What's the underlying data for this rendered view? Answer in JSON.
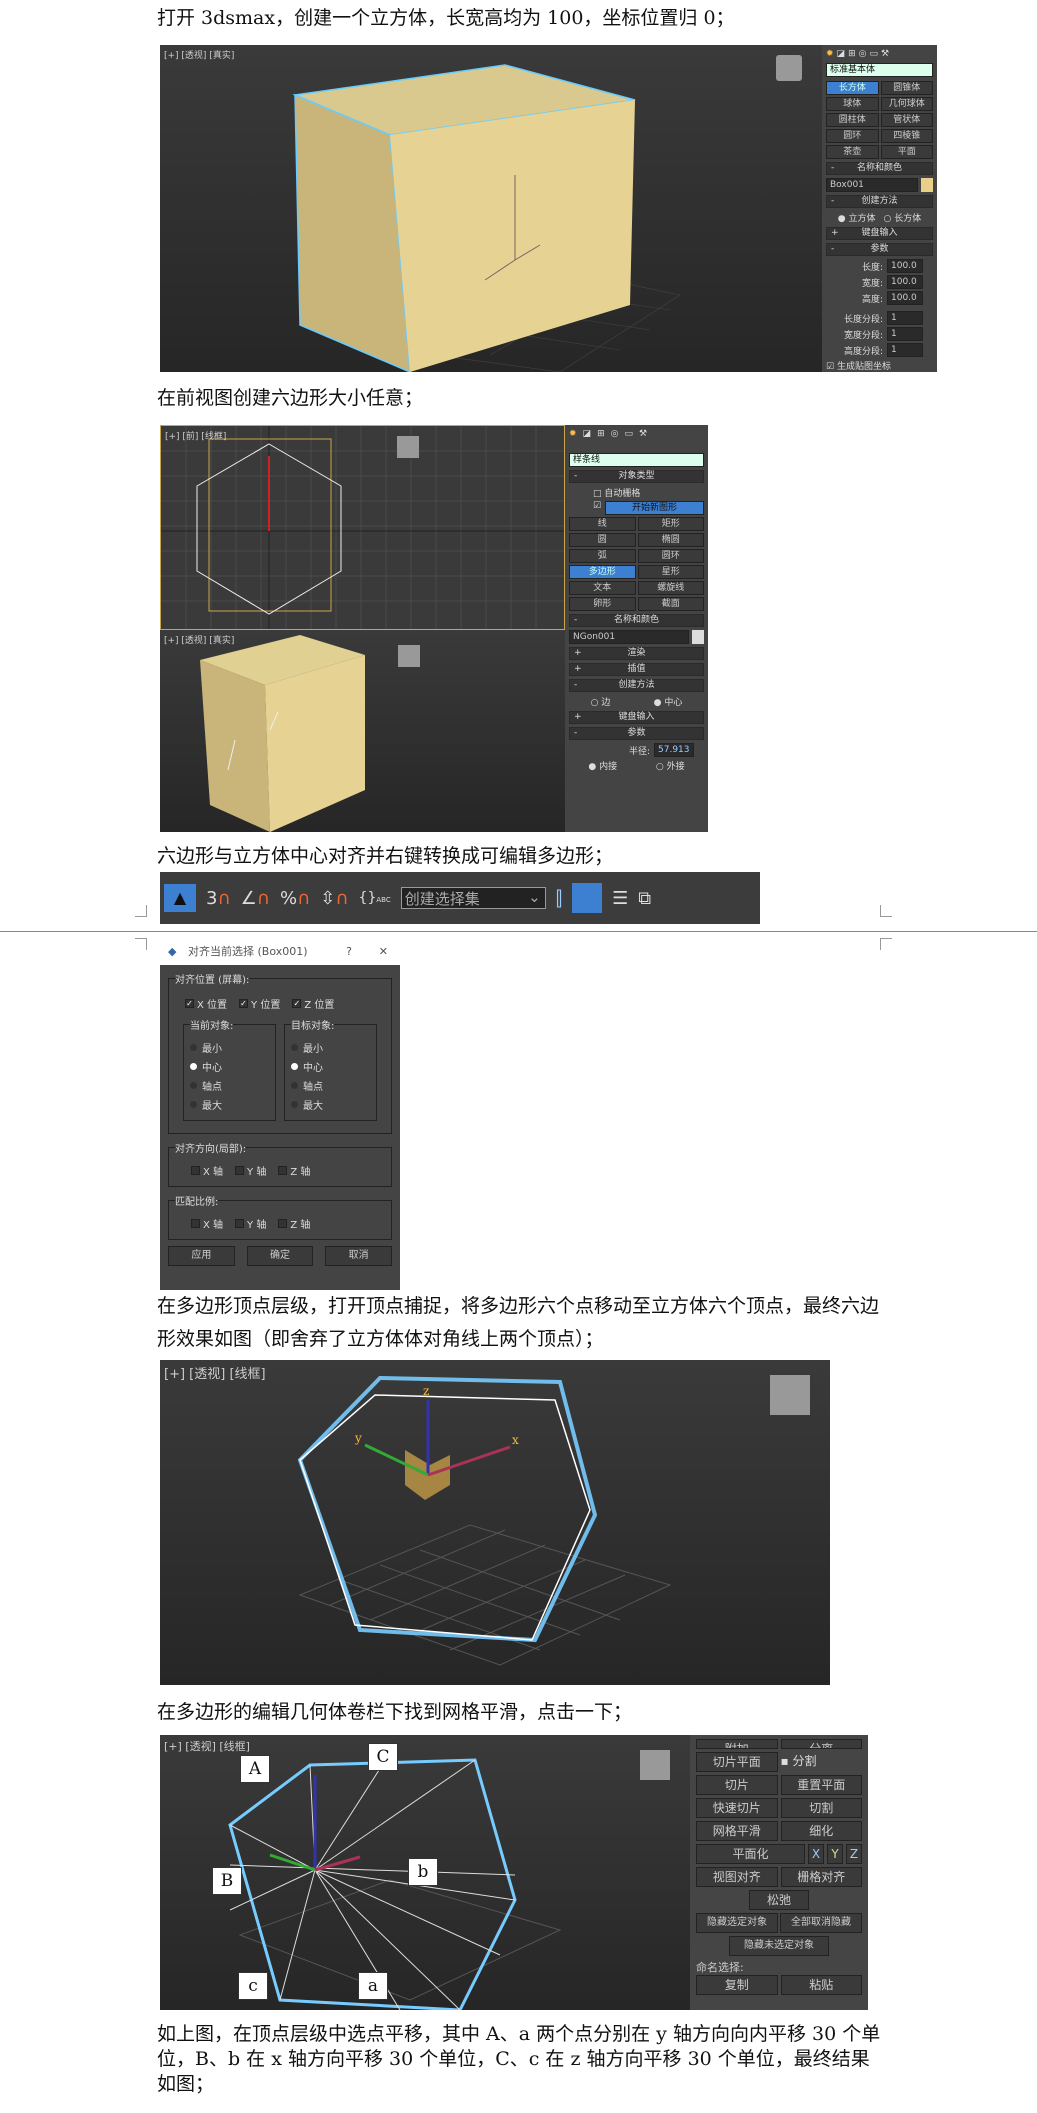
{
  "paragraphs": {
    "p1": "打开 3dsmax，创建一个立方体，长宽高均为 100，坐标位置归 0；",
    "p2": "在前视图创建六边形大小任意；",
    "p3": "六边形与立方体中心对齐并右键转换成可编辑多边形；",
    "p4": "在多边形顶点层级，打开顶点捕捉，将多边形六个点移动至立方体六个顶点，最终六边形效果如图（即舍弃了立方体体对角线上两个顶点）；",
    "p5": "在多边形的编辑几何体卷栏下找到网格平滑，点击一下；",
    "p6": "如上图，在顶点层级中选点平移，其中 A、a 两个点分别在 y 轴方向向内平移 30 个单位，B、b 在 x 轴方向平移 30 个单位，C、c 在 z 轴方向平移 30 个单位，最终结果如图；"
  },
  "shot1": {
    "viewport_label": "[+] [透视] [真实]",
    "dropdown": "标准基本体",
    "object_types": [
      "长方体",
      "圆锥体",
      "球体",
      "几何球体",
      "圆柱体",
      "管状体",
      "圆环",
      "四棱锥",
      "茶壶",
      "平面"
    ],
    "name_color_header": "名称和颜色",
    "name": "Box001",
    "object_color": "#e8d08a",
    "creation_header": "创建方法",
    "creation_options": [
      "立方体",
      "长方体"
    ],
    "keyboard_header": "键盘输入",
    "params_header": "参数",
    "params": [
      {
        "label": "长度:",
        "value": "100.0"
      },
      {
        "label": "宽度:",
        "value": "100.0"
      },
      {
        "label": "高度:",
        "value": "100.0"
      }
    ],
    "segments": [
      {
        "label": "长度分段:",
        "value": "1"
      },
      {
        "label": "宽度分段:",
        "value": "1"
      },
      {
        "label": "高度分段:",
        "value": "1"
      }
    ],
    "gen_mapping": "生成贴图坐标"
  },
  "shot2": {
    "top_label": "[+] [前] [线框]",
    "bottom_label": "[+] [透视] [真实]",
    "dropdown": "样条线",
    "object_type_header": "对象类型",
    "auto_grid": "自动栅格",
    "start_new_shape": "开始新图形",
    "shapes": [
      "线",
      "矩形",
      "圆",
      "椭圆",
      "弧",
      "圆环",
      "多边形",
      "星形",
      "文本",
      "螺旋线",
      "卵形",
      "截面"
    ],
    "name_color_header": "名称和颜色",
    "name": "NGon001",
    "render_header": "渲染",
    "interp_header": "插值",
    "creation_header": "创建方法",
    "creation_options": [
      "边",
      "中心"
    ],
    "keyboard_header": "键盘输入",
    "params_header": "参数",
    "radius_label": "半径:",
    "radius": "57.913",
    "inscribe_options": [
      "内接",
      "外接"
    ]
  },
  "toolbar": {
    "snap_number": "3",
    "selection_set": "创建选择集",
    "abc": "ABC"
  },
  "dialog": {
    "title": "对齐当前选择 (Box001)",
    "help": "?",
    "close": "✕",
    "align_position": "对齐位置 (屏幕):",
    "positions": [
      "X 位置",
      "Y 位置",
      "Z 位置"
    ],
    "current_object": "当前对象:",
    "target_object": "目标对象:",
    "options": [
      "最小",
      "中心",
      "轴点",
      "最大"
    ],
    "align_orientation": "对齐方向(局部):",
    "match_scale": "匹配比例:",
    "axes": [
      "X 轴",
      "Y 轴",
      "Z 轴"
    ],
    "buttons": [
      "应用",
      "确定",
      "取消"
    ]
  },
  "shot4": {
    "viewport_label": "[+] [透视] [线框]",
    "axis_labels": [
      "z",
      "y",
      "x"
    ]
  },
  "shot5": {
    "viewport_label": "[+] [透视] [线框]",
    "point_labels": [
      "A",
      "C",
      "B",
      "b",
      "c",
      "a"
    ],
    "buttons": {
      "top_cut": "附加",
      "top_cut2": "分离",
      "slice_plane": "切片平面",
      "split": "分割",
      "slice": "切片",
      "reset_plane": "重置平面",
      "quick_slice": "快速切片",
      "cut": "切割",
      "meshsmooth": "网格平滑",
      "tessellate": "细化",
      "planarize": "平面化",
      "x": "X",
      "y": "Y",
      "z": "Z",
      "view_align": "视图对齐",
      "grid_align": "栅格对齐",
      "relax": "松弛",
      "hide_sel": "隐藏选定对象",
      "unhide_all": "全部取消隐藏",
      "hide_unsel": "隐藏未选定对象",
      "named_sel": "命名选择:",
      "copy": "复制",
      "paste": "粘贴"
    }
  }
}
